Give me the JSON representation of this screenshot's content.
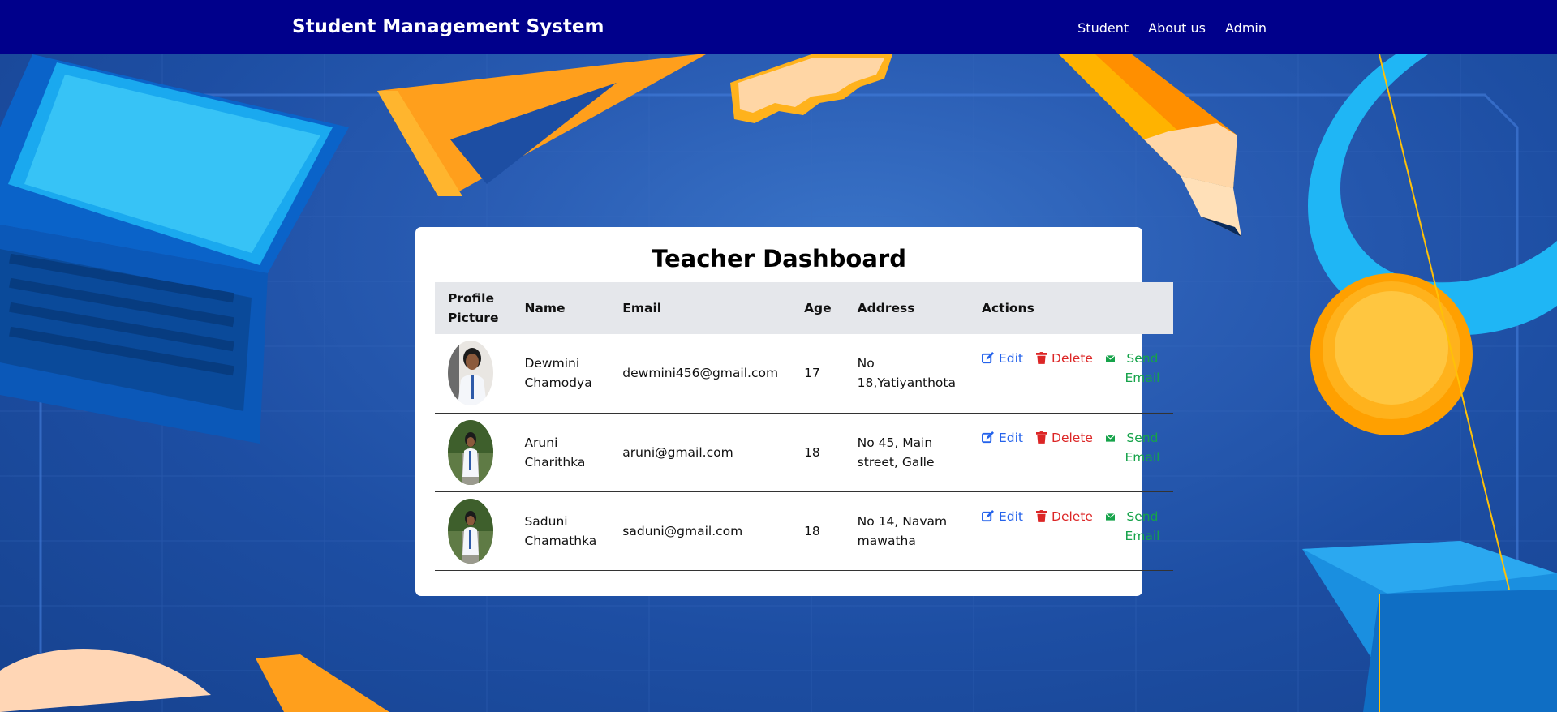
{
  "navbar": {
    "brand": "Student Management System",
    "links": [
      "Student",
      "About us",
      "Admin"
    ],
    "bg_color": "#00008b"
  },
  "dashboard": {
    "title": "Teacher Dashboard",
    "columns": [
      "Profile Picture",
      "Name",
      "Email",
      "Age",
      "Address",
      "Actions"
    ],
    "rows": [
      {
        "name": "Dewmini Chamodya",
        "email": "dewmini456@gmail.com",
        "age": "17",
        "address": "No 18,Yatiyanthota",
        "avatar_icon": "student-photo-icon"
      },
      {
        "name": "Aruni Charithka",
        "email": "aruni@gmail.com",
        "age": "18",
        "address": "No 45, Main street, Galle",
        "avatar_icon": "student-photo-icon"
      },
      {
        "name": "Saduni Chamathka",
        "email": "saduni@gmail.com",
        "age": "18",
        "address": "No 14, Navam mawatha",
        "avatar_icon": "student-photo-icon"
      }
    ],
    "actions": {
      "edit": "Edit",
      "delete": "Delete",
      "send_email": "Send Email"
    }
  },
  "colors": {
    "edit": "#2563eb",
    "delete": "#dc2626",
    "email": "#16a34a",
    "header_bg": "#e5e7eb",
    "page_bg": "#1f4fa6"
  }
}
